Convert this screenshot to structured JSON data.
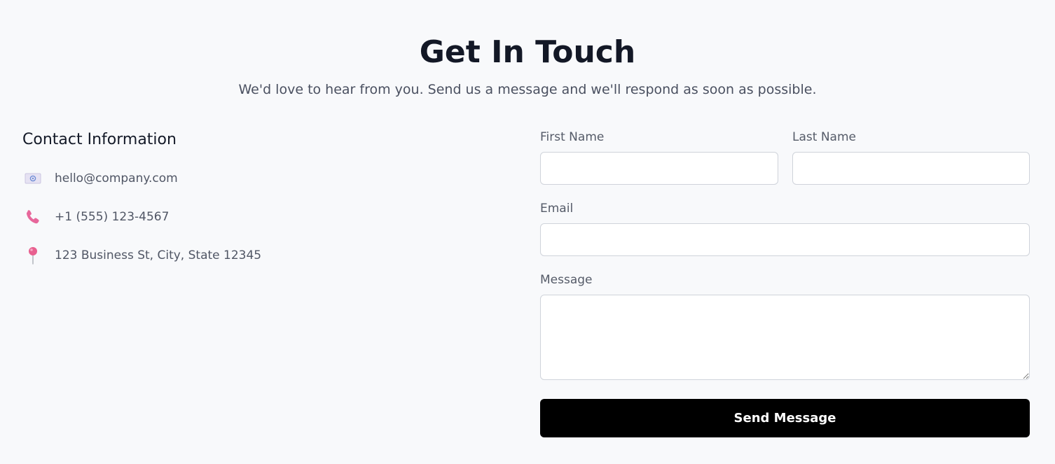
{
  "header": {
    "title": "Get In Touch",
    "subtitle": "We'd love to hear from you. Send us a message and we'll respond as soon as possible."
  },
  "contact": {
    "title": "Contact Information",
    "items": [
      {
        "icon": "envelope-icon",
        "text": "hello@company.com"
      },
      {
        "icon": "phone-icon",
        "text": "+1 (555) 123-4567"
      },
      {
        "icon": "pin-icon",
        "text": "123 Business St, City, State 12345"
      }
    ]
  },
  "form": {
    "first_name_label": "First Name",
    "first_name_value": "",
    "last_name_label": "Last Name",
    "last_name_value": "",
    "email_label": "Email",
    "email_value": "",
    "message_label": "Message",
    "message_value": "",
    "submit_label": "Send Message"
  },
  "colors": {
    "background": "#f8f9fb",
    "button": "#000000",
    "button_text": "#ffffff",
    "icon_pink": "#e7679b"
  }
}
